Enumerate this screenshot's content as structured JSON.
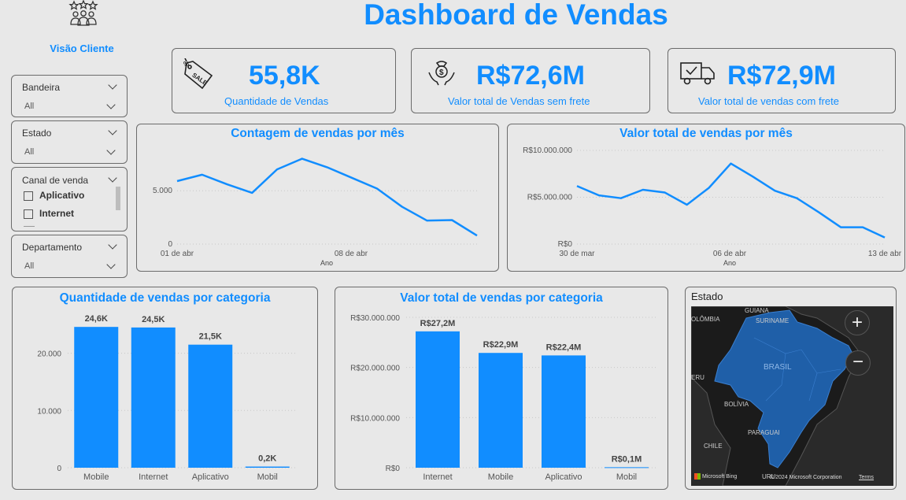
{
  "header": {
    "title": "Dashboard de Vendas",
    "view_label": "Visão Cliente",
    "logo_icon": "customer-rating-icon"
  },
  "slicers": {
    "bandeira": {
      "title": "Bandeira",
      "value": "All"
    },
    "estado": {
      "title": "Estado",
      "value": "All"
    },
    "canal": {
      "title": "Canal de venda",
      "options": [
        "Aplicativo",
        "Internet"
      ]
    },
    "departamento": {
      "title": "Departamento",
      "value": "All"
    }
  },
  "kpis": [
    {
      "value": "55,8K",
      "label": "Quantidade de Vendas",
      "icon": "sale-tag-icon"
    },
    {
      "value": "R$72,6M",
      "label": "Valor total de Vendas sem frete",
      "icon": "money-hand-icon"
    },
    {
      "value": "R$72,9M",
      "label": "Valor total de vendas com frete",
      "icon": "delivery-truck-icon"
    }
  ],
  "colors": {
    "accent": "#118dff",
    "background": "#e8e8e8",
    "border": "#6b6b6b"
  },
  "map": {
    "title": "Estado",
    "labels": [
      "GUIANA",
      "OLÔMBIA",
      "SURINAME",
      "BRASIL",
      "ERU",
      "BOLÍVIA",
      "PARAGUAI",
      "CHILE",
      "URU"
    ],
    "attribution": "Microsoft Bing",
    "copyright": "© 2024 Microsoft Corporation",
    "terms": "Terms"
  },
  "chart_data": [
    {
      "type": "line",
      "title": "Contagem de vendas por mês",
      "xlabel": "Ano",
      "ylabel": "",
      "x_ticks": [
        "01 de abr",
        "08 de abr"
      ],
      "y_ticks": [
        "0",
        "5.000"
      ],
      "ylim": [
        0,
        9000
      ],
      "series": [
        {
          "values": [
            5900,
            6500,
            5600,
            4800,
            7000,
            8000,
            7200,
            6200,
            5200,
            3500,
            2200,
            2250,
            800
          ]
        }
      ]
    },
    {
      "type": "line",
      "title": "Valor total de vendas por mês",
      "xlabel": "Ano",
      "ylabel": "",
      "x_ticks": [
        "30 de mar",
        "06 de abr",
        "13 de abr"
      ],
      "y_ticks": [
        "R$0",
        "R$5.000.000",
        "R$10.000.000"
      ],
      "ylim": [
        0,
        10000000
      ],
      "series": [
        {
          "values": [
            6200000,
            5200000,
            4900000,
            5800000,
            5500000,
            4200000,
            6000000,
            8600000,
            7200000,
            5700000,
            4900000,
            3400000,
            1800000,
            1800000,
            700000
          ]
        }
      ]
    },
    {
      "type": "bar",
      "title": "Quantidade de vendas por categoria",
      "categories": [
        "Mobile",
        "Internet",
        "Aplicativo",
        "Mobil"
      ],
      "values": [
        24600,
        24500,
        21500,
        200
      ],
      "data_labels": [
        "24,6K",
        "24,5K",
        "21,5K",
        "0,2K"
      ],
      "y_ticks": [
        "0",
        "10.000",
        "20.000"
      ],
      "ylim": [
        0,
        26000
      ]
    },
    {
      "type": "bar",
      "title": "Valor total de vendas por categoria",
      "categories": [
        "Internet",
        "Mobile",
        "Aplicativo",
        "Mobil"
      ],
      "values": [
        27200000,
        22900000,
        22400000,
        100000
      ],
      "data_labels": [
        "R$27,2M",
        "R$22,9M",
        "R$22,4M",
        "R$0,1M"
      ],
      "y_ticks": [
        "R$0",
        "R$10.000.000",
        "R$20.000.000",
        "R$30.000.000"
      ],
      "ylim": [
        0,
        30000000
      ]
    }
  ]
}
